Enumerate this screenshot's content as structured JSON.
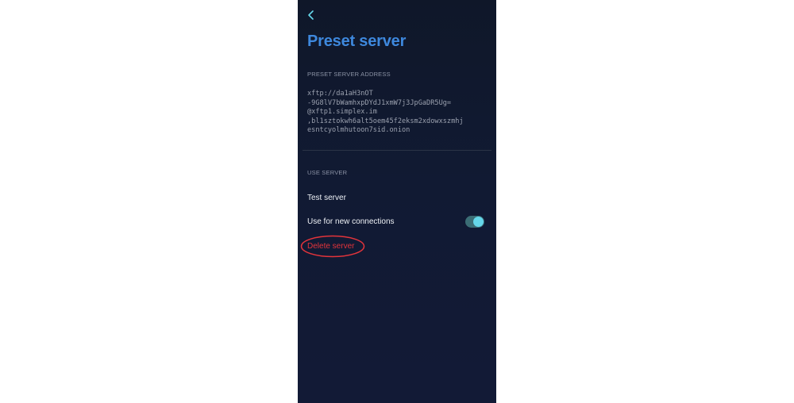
{
  "colors": {
    "title": "#3e88dd",
    "accent": "#65d7ea",
    "danger": "#e3343b",
    "background": "#0f1729"
  },
  "header": {
    "back_icon": "chevron-left-icon",
    "title": "Preset server"
  },
  "address_section": {
    "label": "PRESET SERVER ADDRESS",
    "lines": [
      "xftp://da1aH3nOT",
      "-9G8lV7bWamhxpDYdJ1xmW7j3JpGaDR5Ug=",
      "@xftp1.simplex.im",
      ",bl1sztokwh6alt5oem45f2eksm2xdowxszmhj",
      "esntcyolmhutoon7sid.onion"
    ]
  },
  "use_section": {
    "label": "USE SERVER",
    "test_server": "Test server",
    "use_for_new_connections": "Use for new connections",
    "use_for_new_connections_enabled": true,
    "delete_server": "Delete server"
  }
}
